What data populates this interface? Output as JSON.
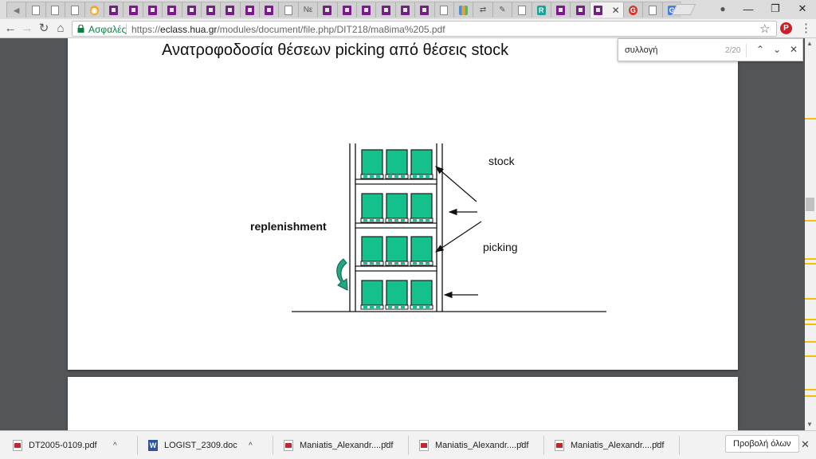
{
  "tabs": {
    "items": [
      {
        "icon": "back-icon",
        "glyph": "◀"
      },
      {
        "icon": "document-icon"
      },
      {
        "icon": "document-icon"
      },
      {
        "icon": "document-icon"
      },
      {
        "icon": "orange-site-icon",
        "glyph": "◉"
      },
      {
        "icon": "pdf-icon"
      },
      {
        "icon": "pdf-icon"
      },
      {
        "icon": "pdf-icon"
      },
      {
        "icon": "pdf-icon"
      },
      {
        "icon": "pdf-icon"
      },
      {
        "icon": "pdf-icon"
      },
      {
        "icon": "pdf-icon"
      },
      {
        "icon": "pdf-icon"
      },
      {
        "icon": "pdf-icon"
      },
      {
        "icon": "document-icon"
      },
      {
        "icon": "text-icon",
        "glyph": "Νε"
      },
      {
        "icon": "pdf-icon"
      },
      {
        "icon": "pdf-icon"
      },
      {
        "icon": "pdf-icon"
      },
      {
        "icon": "pdf-icon"
      },
      {
        "icon": "pdf-icon"
      },
      {
        "icon": "pdf-icon"
      },
      {
        "icon": "document-icon"
      },
      {
        "icon": "colorful-app-icon"
      },
      {
        "icon": "sync-icon",
        "glyph": "⇄"
      },
      {
        "icon": "quill-icon",
        "glyph": "✎"
      },
      {
        "icon": "document-icon"
      },
      {
        "icon": "teal-app-icon",
        "glyph": "R"
      },
      {
        "icon": "pdf-icon"
      },
      {
        "icon": "pdf-icon"
      }
    ],
    "active": {
      "icon": "pdf-icon",
      "close_glyph": "✕"
    },
    "after": [
      {
        "icon": "red-site-icon",
        "glyph": "G"
      },
      {
        "icon": "document-icon"
      },
      {
        "icon": "translate-icon",
        "glyph": "G"
      }
    ]
  },
  "window_controls": {
    "user": "●",
    "minimize": "—",
    "restore": "❐",
    "close": "✕"
  },
  "toolbar": {
    "back": "←",
    "forward": "→",
    "reload": "↻",
    "home": "⌂",
    "secure_label": "Ασφαλές",
    "url_scheme": "https://",
    "url_host": "eclass.hua.gr",
    "url_path": "/modules/document/file.php/DIT218/ma8ima%205.pdf",
    "star": "☆",
    "pinterest": "P",
    "menu": "⋮"
  },
  "find_bar": {
    "query": "συλλογή",
    "count": "2/20",
    "prev": "⌃",
    "next": "⌄",
    "close": "✕"
  },
  "slide": {
    "title": "Ανατροφοδοσία θέσεων picking από θέσεις stock",
    "label_stock": "stock",
    "label_replenishment": "replenishment",
    "label_picking": "picking",
    "rack_levels": 4,
    "pallets_per_level": 3,
    "pallet_color": "#14c08c"
  },
  "downloads": {
    "items": [
      {
        "name": "DT2005-0109.pdf",
        "type": "pdf-icon"
      },
      {
        "name": "LOGIST_2309.doc",
        "type": "word-icon"
      },
      {
        "name": "Maniatis_Alexandr....pdf",
        "type": "pdf-icon"
      },
      {
        "name": "Maniatis_Alexandr....pdf",
        "type": "pdf-icon"
      },
      {
        "name": "Maniatis_Alexandr....pdf",
        "type": "pdf-icon"
      }
    ],
    "chevron": "^",
    "show_all": "Προβολή όλων",
    "close": "✕"
  }
}
